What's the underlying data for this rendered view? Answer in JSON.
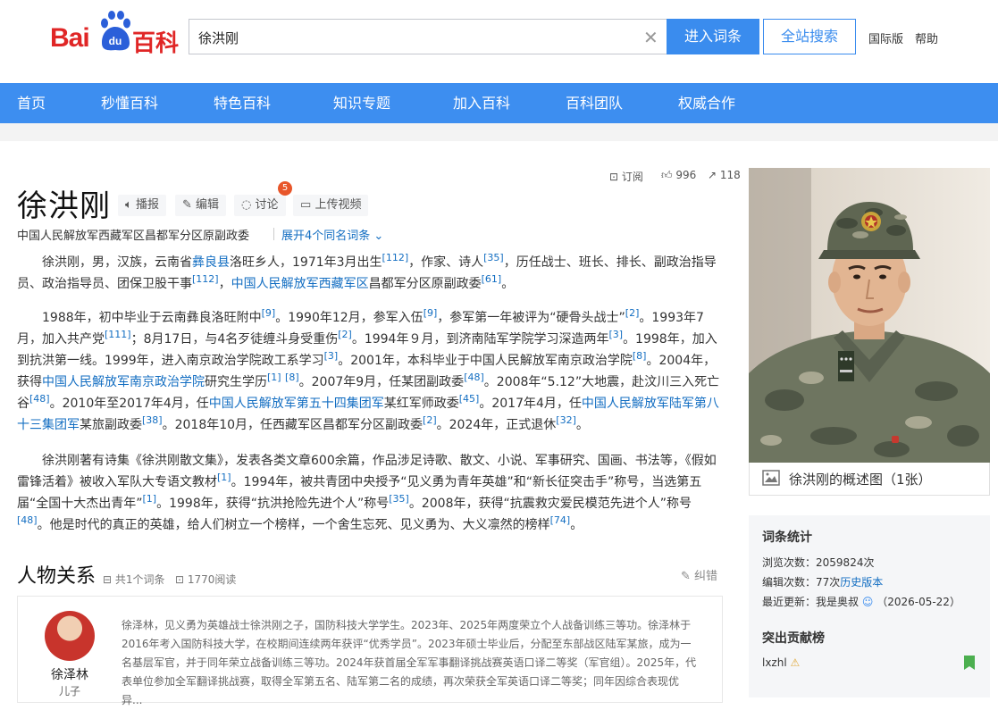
{
  "header": {
    "logo_bai": "Bai",
    "logo_du": "du",
    "logo_baike": "百科",
    "search_value": "徐洪刚",
    "enter_button": "进入词条",
    "site_search_button": "全站搜索",
    "intl_link": "国际版",
    "help_link": "帮助"
  },
  "nav": {
    "items": [
      "首页",
      "秒懂百科",
      "特色百科",
      "知识专题",
      "加入百科",
      "百科团队",
      "权威合作"
    ]
  },
  "entry": {
    "title": "徐洪刚",
    "tools": {
      "broadcast": "播报",
      "edit": "编辑",
      "discuss": "讨论",
      "discuss_count": "5",
      "upload_video": "上传视频"
    },
    "subtitle": "中国人民解放军西藏军区昌都军分区原副政委",
    "same_name": "展开4个同名词条",
    "subscribe": "订阅",
    "likes": "996",
    "shares": "118"
  },
  "para1": {
    "t1": "徐洪刚，男，汉族，云南省",
    "l1": "彝良县",
    "t2": "洛旺乡人，1971年3月出生",
    "s1": "[112]",
    "t3": "，作家、诗人",
    "s2": "[35]",
    "t4": "，历任战士、班长、排长、副政治指导员、政治指导员、团保卫股干事",
    "s3": "[112]",
    "t5": "，",
    "l2": "中国人民解放军西藏军区",
    "t6": "昌都军分区原副政委",
    "s4": "[61]",
    "t7": "。"
  },
  "para2": {
    "t1": "1988年，初中毕业于云南彝良洛旺附中",
    "s1": "[9]",
    "t2": "。1990年12月，参军入伍",
    "s2": "[9]",
    "t3": "，参军第一年被评为“硬骨头战士”",
    "s3": "[2]",
    "t4": "。1993年7月，加入共产党",
    "s4": "[111]",
    "t5": "；8月17日，与4名歹徒缠斗身受重伤",
    "s5": "[2]",
    "t6": "。1994年９月，到济南陆军学院学习深造两年",
    "s6": "[3]",
    "t7": "。1998年，加入到抗洪第一线。1999年，进入南京政治学院政工系学习",
    "s7": "[3]",
    "t8": "。2001年，本科毕业于中国人民解放军南京政治学院",
    "s8": "[8]",
    "t9": "。2004年，获得",
    "l1": "中国人民解放军南京政治学院",
    "t10": "研究生学历",
    "s9": "[1]",
    "s10": "[8]",
    "t11": "。2007年9月，任某团副政委",
    "s11": "[48]",
    "t12": "。2008年“5.12”大地震，赴汶川三入死亡谷",
    "s12": "[48]",
    "t13": "。2010年至2017年4月，任",
    "l2": "中国人民解放军第五十四集团军",
    "t14": "某红军师政委",
    "s13": "[45]",
    "t15": "。2017年4月，任",
    "l3": "中国人民解放军陆军第八十三集团军",
    "t16": "某旅副政委",
    "s14": "[38]",
    "t17": "。2018年10月，任西藏军区昌都军分区副政委",
    "s15": "[2]",
    "t18": "。2024年，正式退休",
    "s16": "[32]",
    "t19": "。"
  },
  "para3": {
    "t1": "徐洪刚著有诗集《徐洪刚散文集》，发表各类文章600余篇，作品涉足诗歌、散文、小说、军事研究、国画、书法等，《假如雷锋活着》被收入军队大专语文教材",
    "s1": "[1]",
    "t2": "。1994年，被共青团中央授予“见义勇为青年英雄”和“新长征突击手”称号，当选第五届“全国十大杰出青年”",
    "s2": "[1]",
    "t3": "。1998年，获得“抗洪抢险先进个人”称号",
    "s3": "[35]",
    "t4": "。2008年，获得“抗震救灾爱民模范先进个人”称号",
    "s4": "[48]",
    "t5": "。他是时代的真正的英雄，给人们树立一个榜样，一个舍生忘死、见义勇为、大义凛然的榜样",
    "s5": "[74]",
    "t6": "。"
  },
  "relations": {
    "title": "人物关系",
    "entries": "共1个词条",
    "reads": "1770阅读",
    "correct": "纠错",
    "person_name": "徐泽林",
    "person_role": "儿子",
    "text": "徐泽林，见义勇为英雄战士徐洪刚之子，国防科技大学学生。2023年、2025年两度荣立个人战备训练三等功。徐泽林于2016年考入国防科技大学，在校期间连续两年获评“优秀学员”。2023年硕士毕业后，分配至东部战区陆军某旅，成为一名基层军官，并于同年荣立战备训练三等功。2024年获首届全军军事翻译挑战赛英语口译二等奖（军官组）。2025年，代表单位参加全军翻译挑战赛，取得全军第五名、陆军第二名的成绩，再次荣获全军英语口译二等奖；同年因综合表现优异..."
  },
  "side": {
    "photo_caption": "徐洪刚的概述图（1张）",
    "stats_title": "词条统计",
    "views_label": "浏览次数：",
    "views": "2059824次",
    "edits_label": "编辑次数：",
    "edits": "77次",
    "history_link": "历史版本",
    "updated_label": "最近更新：",
    "updated_user": "我是奥叔",
    "updated_date": "（2026-05-22）",
    "contrib_title": "突出贡献榜",
    "contrib_user": "lxzhl"
  }
}
